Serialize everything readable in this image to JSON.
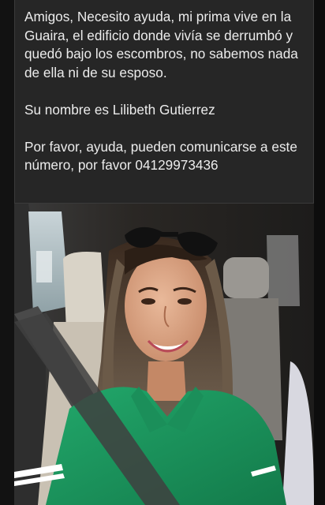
{
  "post": {
    "paragraphs": [
      "Amigos, Necesito ayuda, mi prima vive en la Guaira, el edificio donde vivía se derrumbó y quedó bajo los escombros, no sabemos nada de ella ni de su esposo.",
      "Su nombre es Lilibeth Gutierrez",
      "Por favor, ayuda, pueden comunicarse a este número, por favor 04129973436"
    ]
  },
  "colors": {
    "card_background": "#262626",
    "text": "#ececec",
    "shirt_green": "#1e9c63"
  }
}
